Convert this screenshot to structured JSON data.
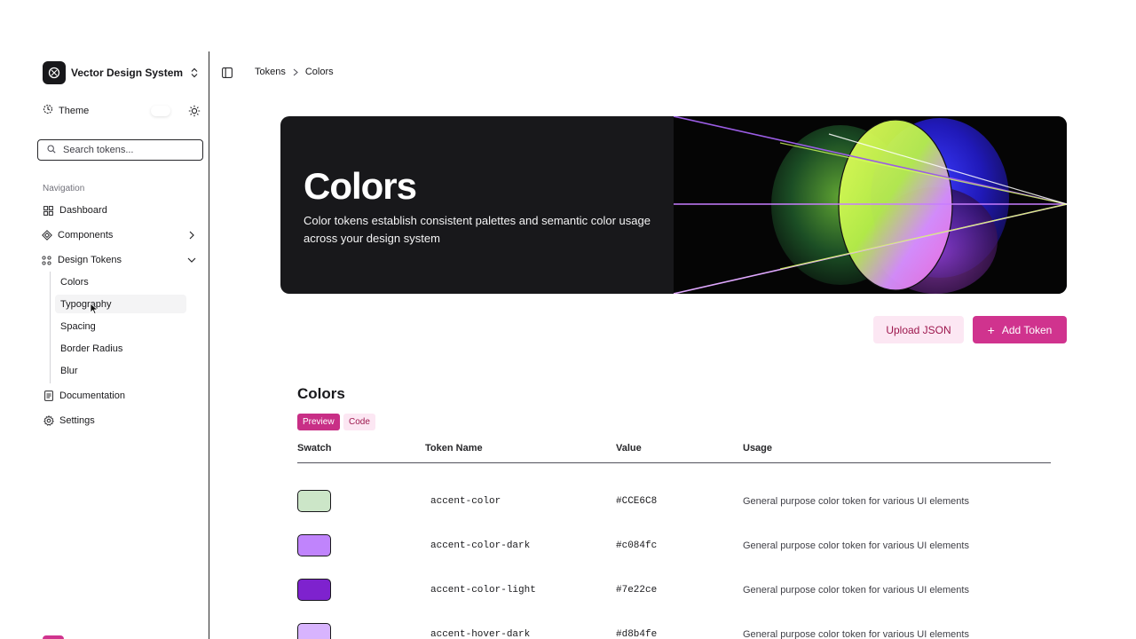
{
  "sidebar": {
    "brand": {
      "name": "Vector Design System"
    },
    "theme": {
      "label": "Theme"
    },
    "search": {
      "placeholder": "Search tokens..."
    },
    "nav_heading": "Navigation",
    "items": [
      {
        "label": "Dashboard"
      },
      {
        "label": "Components"
      },
      {
        "label": "Design Tokens"
      },
      {
        "label": "Documentation"
      },
      {
        "label": "Settings"
      }
    ],
    "sub_items": [
      {
        "label": "Colors"
      },
      {
        "label": "Typography"
      },
      {
        "label": "Spacing"
      },
      {
        "label": "Border Radius"
      },
      {
        "label": "Blur"
      }
    ]
  },
  "breadcrumb": {
    "root": "Tokens",
    "current": "Colors"
  },
  "hero": {
    "title": "Colors",
    "description": "Color tokens establish consistent palettes and semantic color usage across your design system"
  },
  "actions": {
    "upload_label": "Upload JSON",
    "add_label": "Add Token",
    "add_icon": "+"
  },
  "section": {
    "title": "Colors",
    "tabs": [
      {
        "label": "Preview"
      },
      {
        "label": "Code"
      }
    ],
    "columns": {
      "swatch": "Swatch",
      "name": "Token Name",
      "value": "Value",
      "usage": "Usage"
    },
    "rows": [
      {
        "name": "accent-color",
        "value": "#CCE6C8",
        "color": "#CCE6C8",
        "usage": "General purpose color token for various UI elements"
      },
      {
        "name": "accent-color-dark",
        "value": "#c084fc",
        "color": "#c084fc",
        "usage": "General purpose color token for various UI elements"
      },
      {
        "name": "accent-color-light",
        "value": "#7e22ce",
        "color": "#7e22ce",
        "usage": "General purpose color token for various UI elements"
      },
      {
        "name": "accent-hover-dark",
        "value": "#d8b4fe",
        "color": "#d8b4fe",
        "usage": "General purpose color token for various UI elements"
      }
    ]
  },
  "colors": {
    "accent": "#d0338e",
    "accent_soft": "#fce7f3",
    "hero_bg": "#18181b"
  }
}
